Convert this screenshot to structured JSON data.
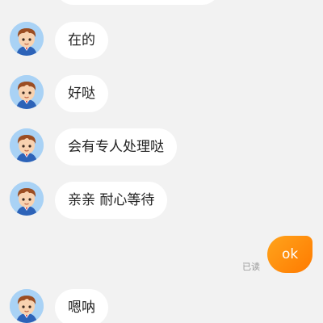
{
  "chat": {
    "incoming_messages": [
      {
        "text": "在的"
      },
      {
        "text": "好哒"
      },
      {
        "text": "会有专人处理哒"
      },
      {
        "text": "亲亲 耐心等待"
      },
      {
        "text": "嗯呐"
      }
    ],
    "outgoing_message": {
      "text": "ok",
      "read_status": "已读"
    }
  },
  "colors": {
    "background": "#f2f2f2",
    "incoming_bubble": "#ffffff",
    "outgoing_bubble": "#ff8f0a",
    "read_status": "#999999",
    "avatar_bg": "#a9d2f5"
  },
  "icons": {
    "agent_avatar": "cartoon-agent-avatar-icon"
  }
}
